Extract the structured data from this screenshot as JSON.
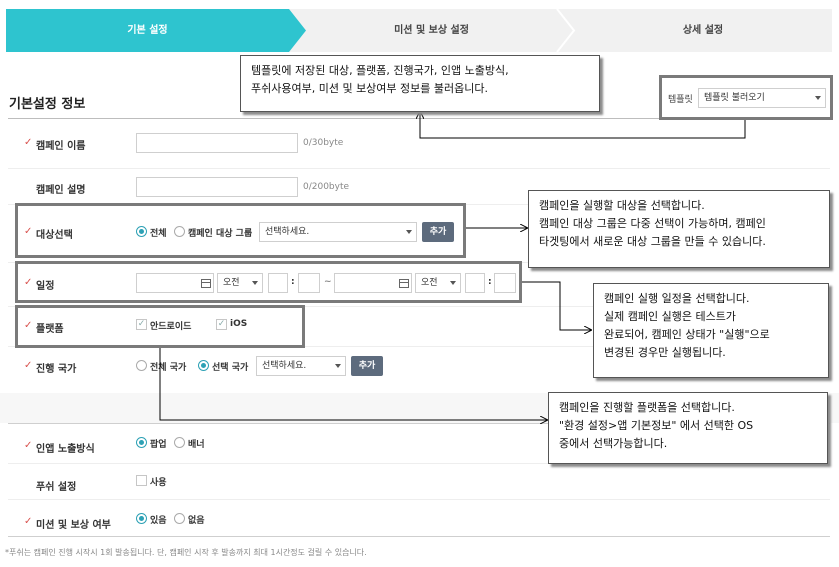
{
  "steps": [
    {
      "label": "기본 설정",
      "active": true
    },
    {
      "label": "미션 및 보상 설정",
      "active": false
    },
    {
      "label": "상세 설정",
      "active": false
    }
  ],
  "section_title": "기본설정 정보",
  "template": {
    "label": "템플릿",
    "select_value": "템플릿 불러오기"
  },
  "fields": {
    "campaign_name": {
      "label": "캠페인 이름",
      "counter": "0/30byte"
    },
    "campaign_desc": {
      "label": "캠페인 설명",
      "counter": "0/200byte"
    },
    "target": {
      "label": "대상선택",
      "opt_all": "전체",
      "opt_group": "캠페인 대상 그룹",
      "select_placeholder": "선택하세요.",
      "add_button": "추가"
    },
    "schedule": {
      "label": "일정",
      "ampm_start": "오전",
      "ampm_end": "오전",
      "range_sep": "~",
      "colon": ":"
    },
    "platform": {
      "label": "플랫폼",
      "android": "안드로이드",
      "ios": "iOS"
    },
    "country": {
      "label": "진행 국가",
      "opt_all": "전체 국가",
      "opt_select": "선택 국가",
      "select_placeholder": "선택하세요.",
      "add_button": "추가"
    },
    "inapp": {
      "label": "인앱 노출방식",
      "opt_popup": "팝업",
      "opt_banner": "배너"
    },
    "push": {
      "label": "푸쉬 설정",
      "opt_use": "사용"
    },
    "mission": {
      "label": "미션 및 보상 여부",
      "opt_yes": "있음",
      "opt_no": "없음"
    }
  },
  "callouts": {
    "template": [
      "템플릿에 저장된 대상, 플랫폼, 진행국가, 인앱 노출방식,",
      "푸쉬사용여부, 미션 및 보상여부 정보를 불러옵니다."
    ],
    "target": [
      "캠페인을 실행할 대상을 선택합니다.",
      "캠페인 대상 그룹은 다중 선택이 가능하며, 캠페인",
      "타겟팅에서 새로운 대상 그룹을 만들 수 있습니다."
    ],
    "schedule": [
      "캠페인 실행 일정을 선택합니다.",
      "실제 캠페인 실행은 테스트가",
      "완료되어, 캠페인 상태가 \"실행\"으로",
      "변경된 경우만 실행됩니다."
    ],
    "platform": [
      "캠페인을 진행할 플랫폼을 선택합니다.",
      "\"환경 설정>앱 기본정보\" 에서 선택한 OS",
      "중에서 선택가능합니다."
    ]
  },
  "footnote": "*푸쉬는 캠페인 진행 시작시 1회 발송됩니다. 단, 캠페인 시작 후 발송까지 최대 1시간정도 걸릴 수 있습니다.",
  "colors": {
    "active_step": "#2ec4cf",
    "accent": "#2da1b5",
    "required": "#d9534f",
    "button": "#5d6b7d"
  }
}
